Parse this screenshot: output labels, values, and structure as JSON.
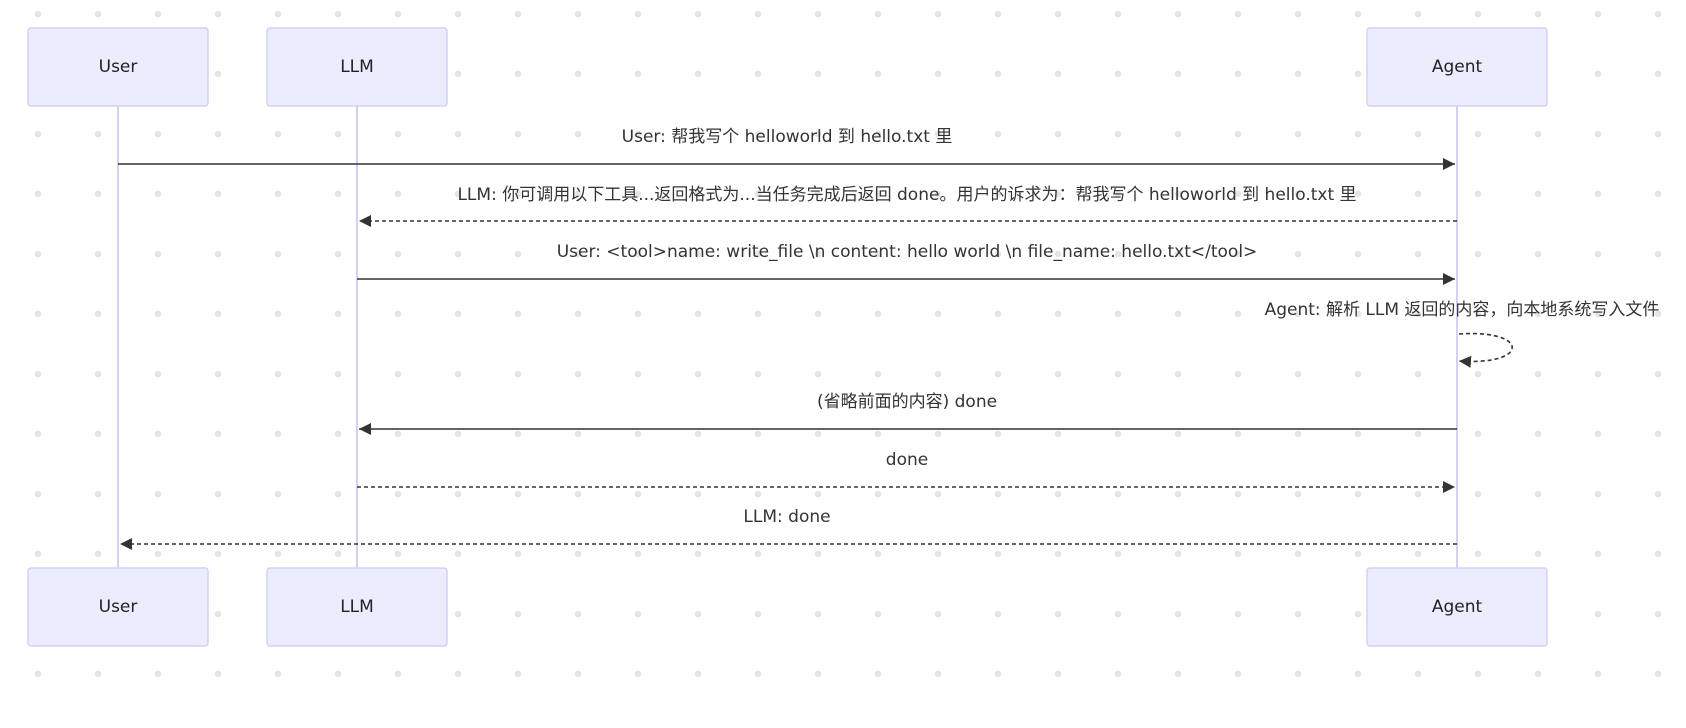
{
  "participants": {
    "user": "User",
    "llm": "LLM",
    "agent": "Agent"
  },
  "messages": [
    {
      "text": "User: 帮我写个 helloworld 到 hello.txt 里",
      "style": "solid"
    },
    {
      "text": "LLM: 你可调用以下工具...返回格式为...当任务完成后返回 done。用户的诉求为：帮我写个 helloworld 到 hello.txt 里",
      "style": "dotted"
    },
    {
      "text": "User: <tool>name: write_file \\n content: hello world \\n file_name: hello.txt</tool>",
      "style": "solid"
    },
    {
      "text": "Agent: 解析 LLM 返回的内容，向本地系统写入文件",
      "style": "dotted"
    },
    {
      "text": "(省略前面的内容) done",
      "style": "solid"
    },
    {
      "text": "done",
      "style": "dotted"
    },
    {
      "text": "LLM: done",
      "style": "dotted"
    }
  ],
  "colors": {
    "actor_fill": "#ececff",
    "actor_border": "#d3d0f5",
    "line": "#333333"
  }
}
